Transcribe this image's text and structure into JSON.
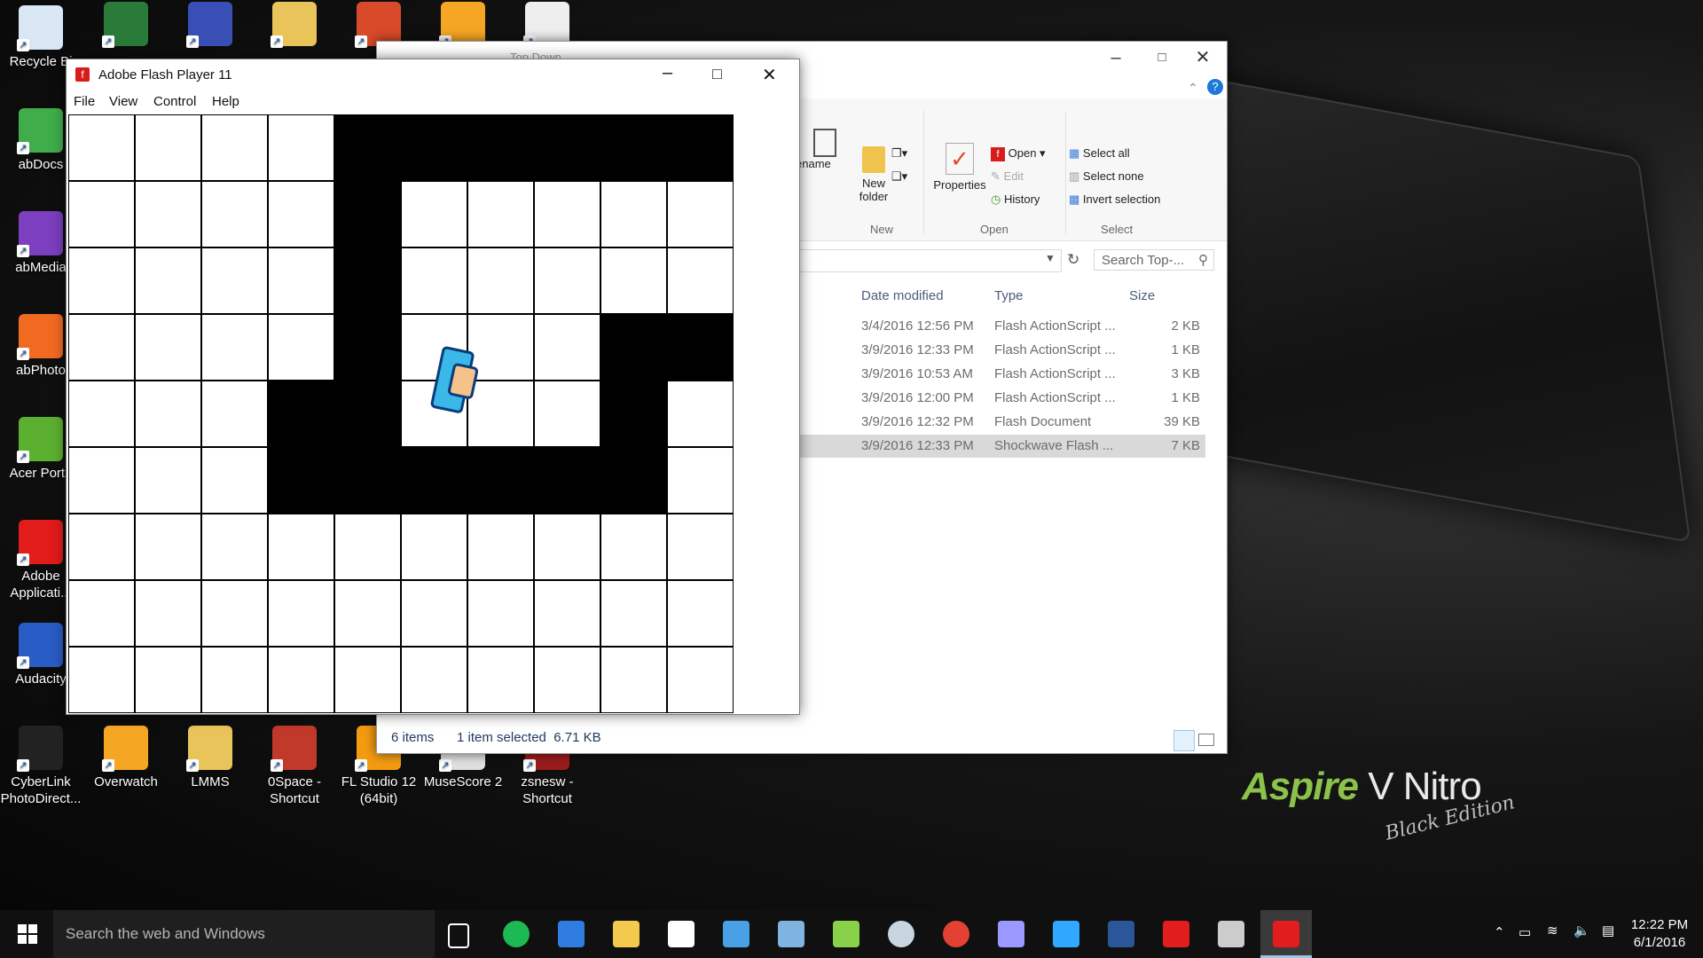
{
  "desktop": {
    "wallpaper_brand": "Aspire",
    "wallpaper_model": "V Nitro",
    "wallpaper_edition": "Black Edition",
    "icons_left": [
      {
        "label": "Recycle Bi",
        "icon": "recycle-bin-icon",
        "color": "#d9e7f5"
      },
      {
        "label": "abDocs",
        "icon": "docs-icon",
        "color": "#3fae4a"
      },
      {
        "label": "abMedia",
        "icon": "media-icon",
        "color": "#7b3fbf"
      },
      {
        "label": "abPhoto",
        "icon": "photo-icon",
        "color": "#f26a21"
      },
      {
        "label": "Acer Porta",
        "icon": "portal-icon",
        "color": "#5cb030"
      },
      {
        "label": "Adobe Applicati...",
        "icon": "adobe-icon",
        "color": "#e21b1b"
      },
      {
        "label": "Audacity",
        "icon": "audacity-icon",
        "color": "#2a5cc5"
      },
      {
        "label": "CyberLink PhotoDirect...",
        "icon": "cyberlink-icon",
        "color": "#222222"
      }
    ],
    "icons_bottom": [
      {
        "label": "Overwatch",
        "icon": "overwatch-icon",
        "color": "#f5a623"
      },
      {
        "label": "LMMS",
        "icon": "folder-icon",
        "color": "#e8c45a"
      },
      {
        "label": "0Space - Shortcut",
        "icon": "devil-icon",
        "color": "#c0392b"
      },
      {
        "label": "FL Studio 12 (64bit)",
        "icon": "fl-studio-icon",
        "color": "#f39c12"
      },
      {
        "label": "MuseScore 2",
        "icon": "musescore-icon",
        "color": "#e0e0e0"
      },
      {
        "label": "zsnesw - Shortcut",
        "icon": "zsnes-icon",
        "color": "#9b1c1c"
      }
    ],
    "icons_top": [
      {
        "icon": "video-icon",
        "color": "#2a7a3a"
      },
      {
        "icon": "network-icon",
        "color": "#3a4fb5"
      },
      {
        "icon": "folder-icon",
        "color": "#e8c45a"
      },
      {
        "icon": "app-icon",
        "color": "#d84a2a"
      },
      {
        "icon": "fruit-icon",
        "color": "#f5a623"
      },
      {
        "icon": "file-icon",
        "color": "#eeeeee"
      }
    ]
  },
  "explorer": {
    "title": "Top Down",
    "ribbon": {
      "rename": "ename",
      "new_folder": "New folder",
      "group_new": "New",
      "properties": "Properties",
      "open": "Open",
      "edit": "Edit",
      "history": "History",
      "group_open": "Open",
      "select_all": "Select all",
      "select_none": "Select none",
      "invert_selection": "Invert selection",
      "group_select": "Select"
    },
    "search_placeholder": "Search Top-...",
    "columns": {
      "date": "Date modified",
      "type": "Type",
      "size": "Size"
    },
    "files": [
      {
        "date": "3/4/2016 12:56 PM",
        "type": "Flash ActionScript ...",
        "size": "2 KB",
        "selected": false
      },
      {
        "date": "3/9/2016 12:33 PM",
        "type": "Flash ActionScript ...",
        "size": "1 KB",
        "selected": false
      },
      {
        "date": "3/9/2016 10:53 AM",
        "type": "Flash ActionScript ...",
        "size": "3 KB",
        "selected": false
      },
      {
        "date": "3/9/2016 12:00 PM",
        "type": "Flash ActionScript ...",
        "size": "1 KB",
        "selected": false
      },
      {
        "date": "3/9/2016 12:32 PM",
        "type": "Flash Document",
        "size": "39 KB",
        "selected": false
      },
      {
        "date": "3/9/2016 12:33 PM",
        "type": "Shockwave Flash ...",
        "size": "7 KB",
        "selected": true
      }
    ],
    "status_items": "6 items",
    "status_selected": "1 item selected  6.71 KB"
  },
  "flash": {
    "title": "Adobe Flash Player 11",
    "menu": [
      "File",
      "View",
      "Control",
      "Help"
    ],
    "grid": [
      "0000111111",
      "0000100000",
      "0000100000",
      "0000100011",
      "0001100010",
      "0001111110",
      "0000000000",
      "0000000000",
      "0000000000"
    ],
    "player": {
      "body_color": "#3bb7e8",
      "head_color": "#f6c28b",
      "col": 6,
      "row": 4
    }
  },
  "taskbar": {
    "search_placeholder": "Search the web and Windows",
    "apps": [
      {
        "icon": "task-view-icon",
        "color": "#ffffff"
      },
      {
        "icon": "spotify-icon",
        "color": "#1db954"
      },
      {
        "icon": "edge-icon",
        "color": "#2f7de1"
      },
      {
        "icon": "file-explorer-icon",
        "color": "#f3c94e"
      },
      {
        "icon": "store-icon",
        "color": "#ffffff"
      },
      {
        "icon": "app-icon",
        "color": "#4aa0e6"
      },
      {
        "icon": "news-icon",
        "color": "#7fb3e0"
      },
      {
        "icon": "cloud-icon",
        "color": "#8ad14a"
      },
      {
        "icon": "steam-icon",
        "color": "#c7d5e0"
      },
      {
        "icon": "chrome-icon",
        "color": "#e34133"
      },
      {
        "icon": "after-effects-icon",
        "color": "#9999ff"
      },
      {
        "icon": "photoshop-icon",
        "color": "#31a8ff"
      },
      {
        "icon": "word-icon",
        "color": "#2b579a"
      },
      {
        "icon": "flash-pro-icon",
        "color": "#e11d1d"
      },
      {
        "icon": "app-icon",
        "color": "#cccccc"
      },
      {
        "icon": "flash-player-icon",
        "color": "#e11d1d"
      }
    ],
    "time": "12:22 PM",
    "date": "6/1/2016"
  }
}
